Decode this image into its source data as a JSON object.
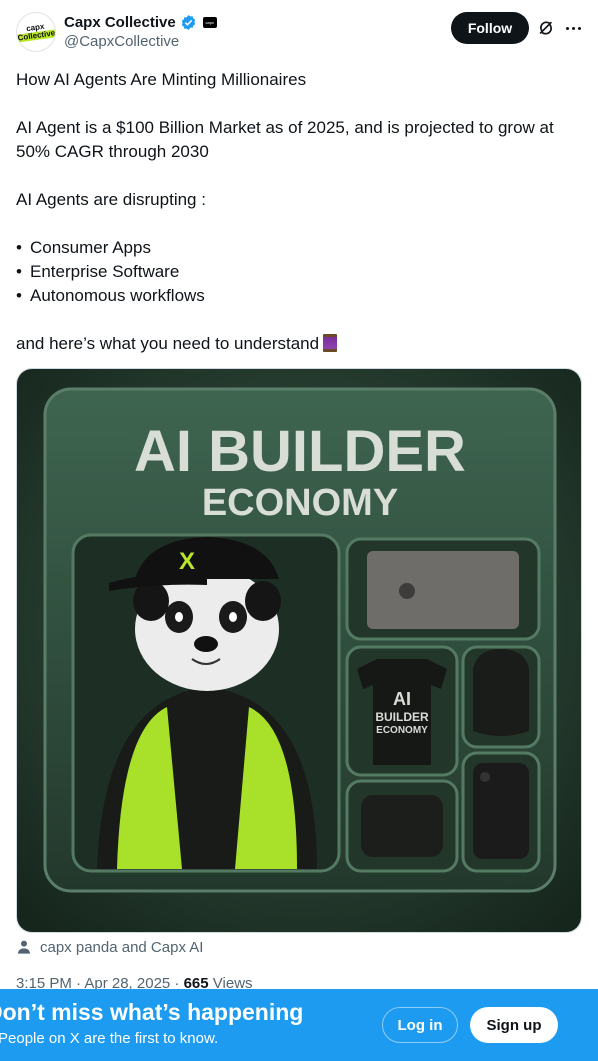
{
  "author": {
    "name": "Capx Collective",
    "handle": "@CapxCollective",
    "avatar_text_1": "capx",
    "avatar_text_2": "Collective",
    "affiliate_badge_text": "capx"
  },
  "actions": {
    "follow_label": "Follow",
    "grok_icon": "grok-icon",
    "more_icon": "more-icon"
  },
  "tweet": {
    "line1": "How AI Agents Are Minting Millionaires",
    "line2": "AI Agent is a $100 Billion Market as of 2025, and is projected to grow at 50% CAGR through 2030",
    "line3": "AI Agents are disrupting :",
    "bullets": [
      "Consumer Apps",
      "Enterprise Software",
      "Autonomous workflows"
    ],
    "bullet_char": "•",
    "line4": "and here’s what you need to understand"
  },
  "media": {
    "headline_1": "AI BUILDER",
    "headline_2": "ECONOMY",
    "shirt_1": "AI",
    "shirt_2": "BUILDER",
    "shirt_3": "ECONOMY",
    "cap_letter": "X"
  },
  "tagged": "capx panda and Capx AI",
  "meta": {
    "time": "3:15 PM · Apr 28, 2025 · ",
    "views_count": "665",
    "views_label": " Views"
  },
  "banner": {
    "title": "Don’t miss what’s happening",
    "subtitle": "People on X are the first to know.",
    "login_label": "Log in",
    "signup_label": "Sign up"
  },
  "colors": {
    "accent": "#1d9bf0",
    "text": "#0f1419",
    "muted": "#536471",
    "lime": "#b9e52a"
  }
}
